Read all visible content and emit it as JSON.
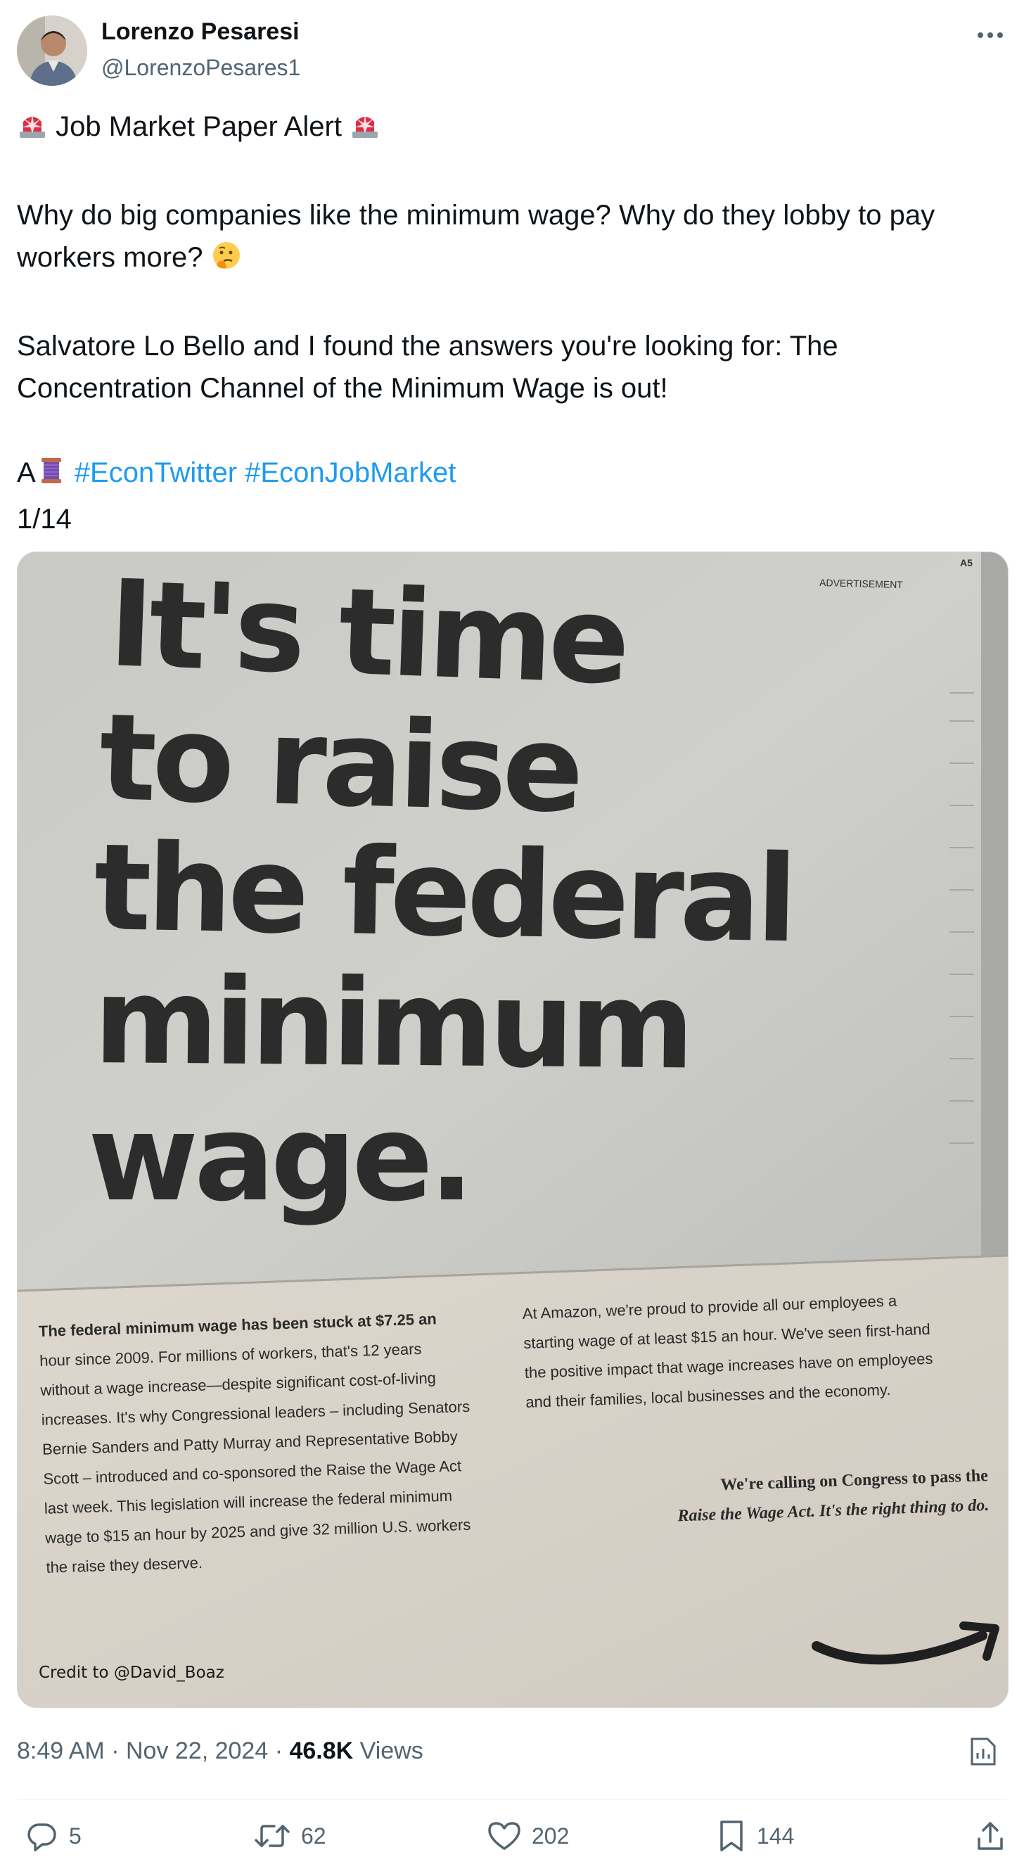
{
  "author": {
    "name": "Lorenzo Pesaresi",
    "handle": "@LorenzoPesares1"
  },
  "tweet": {
    "line1": "Job Market Paper Alert",
    "line2a": "Why do big companies like the minimum wage? Why do they lobby to pay",
    "line2b": "workers more?",
    "line3a": "Salvatore Lo Bello and I found the answers you're looking for: The",
    "line3b": "Concentration Channel of the Minimum Wage is out!",
    "line4_prefix": "A",
    "hashtag1": "#EconTwitter",
    "hashtag2": "#EconJobMarket",
    "thread_count": "1/14"
  },
  "media": {
    "page_number": "A5",
    "ad_label": "ADVERTISEMENT",
    "headline": [
      "It's time",
      "to raise",
      "the federal",
      "minimum",
      "wage."
    ],
    "left_col": [
      "The federal minimum wage has been stuck at $7.25 an",
      "hour since 2009. For millions of workers, that's 12 years",
      "without a wage increase—despite significant cost-of-living",
      "increases. It's why Congressional leaders – including Senators",
      "Bernie Sanders and Patty Murray and Representative Bobby",
      "Scott – introduced and co-sponsored the Raise the Wage Act",
      "last week. This legislation will increase the federal minimum",
      "wage to $15 an hour by 2025 and give 32 million U.S. workers",
      "the raise they deserve."
    ],
    "right_col": [
      "At Amazon, we're proud to provide all our employees a",
      "starting wage of at least $15 an hour. We've seen first-hand",
      "the positive impact that wage increases have on employees",
      "and their families, local businesses and the economy."
    ],
    "callout": [
      "We're calling on Congress to pass the",
      "Raise the Wage Act. It's the right thing to do."
    ],
    "credit": "Credit to @David_Boaz"
  },
  "meta": {
    "time": "8:49 AM",
    "sep1": "·",
    "date": "Nov 22, 2024",
    "sep2": "·",
    "views_count": "46.8K",
    "views_label": "Views"
  },
  "actions": {
    "replies": "5",
    "reposts": "62",
    "likes": "202",
    "bookmarks": "144"
  },
  "icons": {
    "siren": "police-siren-icon",
    "thinking": "thinking-face-icon",
    "thread": "spool-of-thread-icon",
    "more": "more-dots-icon",
    "analytics": "analytics-icon",
    "reply": "reply-icon",
    "repost": "repost-icon",
    "like": "like-icon",
    "bookmark": "bookmark-icon",
    "share": "share-icon"
  },
  "colors": {
    "hashtag": "#1d9bf0",
    "muted": "#536471",
    "text": "#0f1419"
  }
}
